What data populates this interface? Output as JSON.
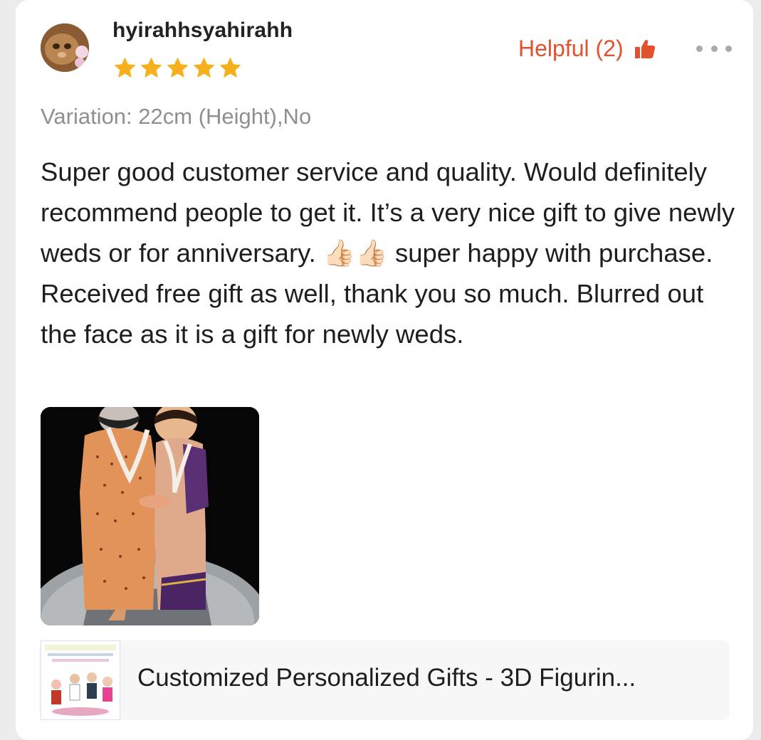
{
  "review": {
    "username": "hyirahhsyahirahh",
    "rating": 5,
    "max_rating": 5,
    "helpful_label": "Helpful (2)",
    "variation": "Variation: 22cm (Height),No",
    "text": "Super good customer service and quality. Would definitely recommend people to get it. It’s a very nice gift to give newly weds or for anniversary. 👍🏻👍🏻 super happy with purchase. Received free gift as well, thank you so much. Blurred out the face as it is a gift for newly weds."
  },
  "product": {
    "title": "Customized Personalized Gifts - 3D Figurin..."
  },
  "colors": {
    "accent": "#e2522f",
    "star": "#f6b01e",
    "muted_text": "#8f8f8f",
    "body_text": "#1e1e1e"
  },
  "icons": {
    "helpful": "thumbs-up-icon",
    "more": "more-options-icon",
    "star": "star-icon"
  }
}
